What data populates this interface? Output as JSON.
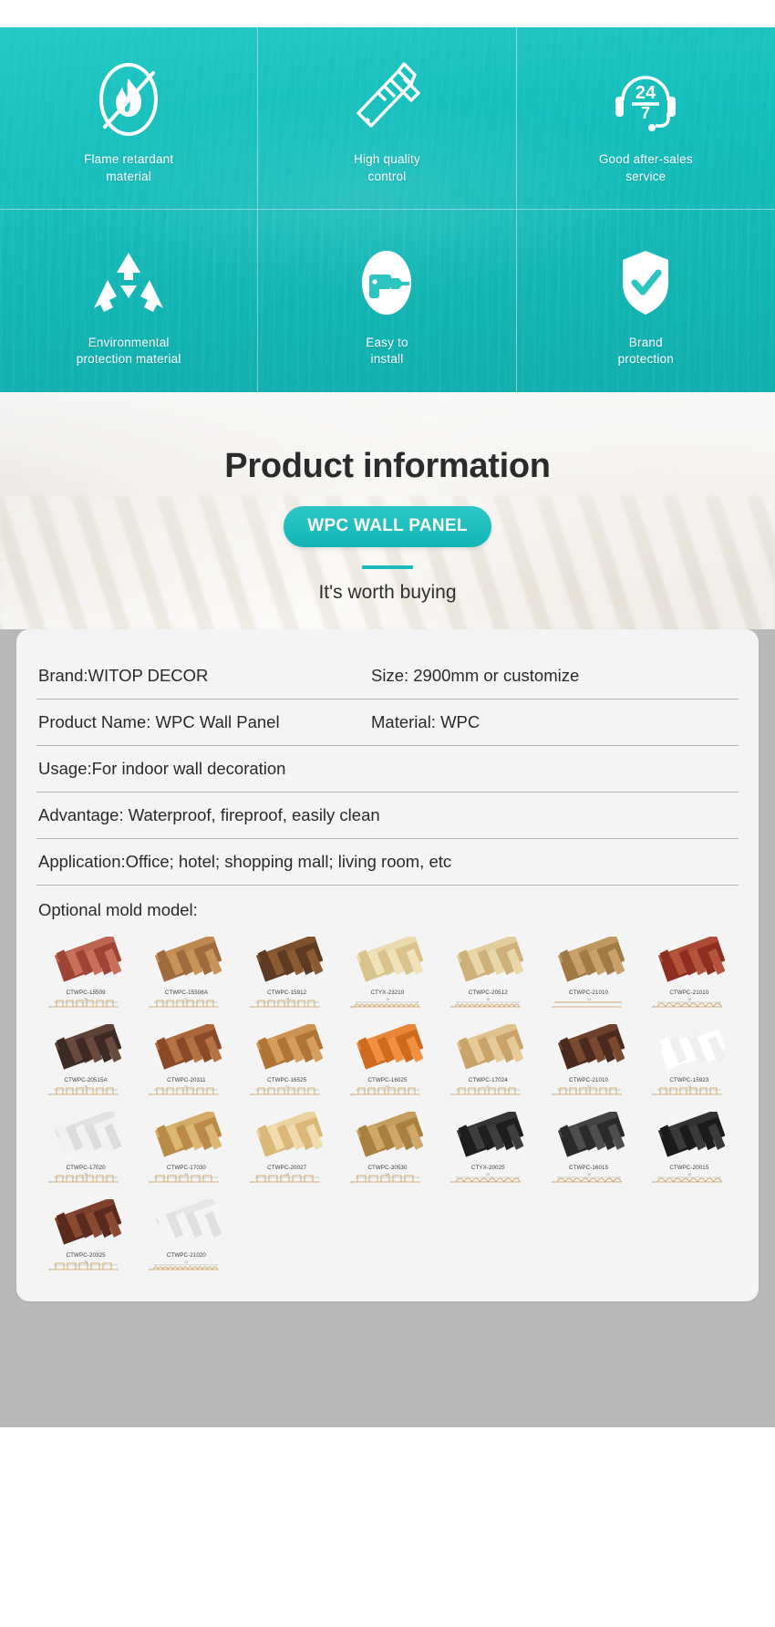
{
  "banner": {
    "features": [
      {
        "icon": "flame-retardant-icon",
        "line1": "Flame retardant",
        "line2": "material"
      },
      {
        "icon": "caliper-quality-icon",
        "line1": "High quality",
        "line2": "control"
      },
      {
        "icon": "headset-24-7-icon",
        "line1": "Good after-sales",
        "line2": "service"
      },
      {
        "icon": "recycle-icon",
        "line1": "Environmental",
        "line2": "protection material"
      },
      {
        "icon": "drill-install-icon",
        "line1": "Easy to",
        "line2": "install"
      },
      {
        "icon": "shield-check-icon",
        "line1": "Brand",
        "line2": "protection"
      }
    ]
  },
  "info": {
    "title": "Product information",
    "pill_label": "WPC WALL PANEL",
    "subtitle": "It's worth buying",
    "accent_color": "#19bcbc"
  },
  "specs": {
    "rows": [
      {
        "left": "Brand:WITOP DECOR",
        "right": "Size: 2900mm or customize"
      },
      {
        "left": "Product Name: WPC Wall Panel",
        "right": "Material: WPC"
      },
      {
        "full": "Usage:For indoor wall decoration"
      },
      {
        "full": "Advantage: Waterproof, fireproof, easily clean"
      },
      {
        "full": "Application:Office; hotel; shopping mall; living room, etc"
      }
    ],
    "mold_title": "Optional mold model:"
  },
  "molds": [
    {
      "code": "CTWPC-15509",
      "dim": "16",
      "color_a": "#9e4436",
      "color_b": "#c8705c",
      "profile": "fluted"
    },
    {
      "code": "CTWPC-15508A",
      "dim": "21",
      "color_a": "#a06b3c",
      "color_b": "#c79358",
      "profile": "fluted"
    },
    {
      "code": "CTWPC-15912",
      "dim": "19",
      "color_a": "#5d3a22",
      "color_b": "#8a5a33",
      "profile": "fluted"
    },
    {
      "code": "CTYX-23210",
      "dim": "18",
      "color_a": "#d9c28c",
      "color_b": "#efe2b9",
      "profile": "wave"
    },
    {
      "code": "CTWPC-20512",
      "dim": "18",
      "color_a": "#cdb07a",
      "color_b": "#e8d7a8",
      "profile": "wave"
    },
    {
      "code": "CTWPC-21010",
      "dim": "14",
      "color_a": "#a07a45",
      "color_b": "#c9a269",
      "profile": "flat"
    },
    {
      "code": "CTWPC-21010",
      "dim": "28",
      "color_a": "#8c2f20",
      "color_b": "#b5543c",
      "profile": "arch"
    },
    {
      "code": "CTWPC-20515A",
      "dim": "25",
      "color_a": "#3d2a24",
      "color_b": "#6a4a3c",
      "profile": "square"
    },
    {
      "code": "CTWPC-20311",
      "dim": "20",
      "color_a": "#8a4a28",
      "color_b": "#b57242",
      "profile": "square"
    },
    {
      "code": "CTWPC-16525",
      "dim": "22",
      "color_a": "#b07436",
      "color_b": "#d69e5c",
      "profile": "square"
    },
    {
      "code": "CTWPC-16025",
      "dim": "20",
      "color_a": "#d06a1f",
      "color_b": "#f09040",
      "profile": "box"
    },
    {
      "code": "CTWPC-17024",
      "dim": "21",
      "color_a": "#c8a46a",
      "color_b": "#e6cb98",
      "profile": "box"
    },
    {
      "code": "CTWPC-21010",
      "dim": "22",
      "color_a": "#4a2a1c",
      "color_b": "#7a4a30",
      "profile": "box"
    },
    {
      "code": "CTWPC-15923",
      "dim": "24",
      "color_a": "#ffffff",
      "color_b": "#efefef",
      "profile": "white-box"
    },
    {
      "code": "CTWPC-17020",
      "dim": "24",
      "color_a": "#f2f2f2",
      "color_b": "#dcdcdc",
      "profile": "white-box"
    },
    {
      "code": "CTWPC-17030",
      "dim": "19",
      "color_a": "#b98b46",
      "color_b": "#dcb673",
      "profile": "step"
    },
    {
      "code": "CTWPC-20027",
      "dim": "20",
      "color_a": "#d9b87a",
      "color_b": "#f0dcac",
      "profile": "step"
    },
    {
      "code": "CTWPC-30530",
      "dim": "28",
      "color_a": "#a9803f",
      "color_b": "#cfa868",
      "profile": "step"
    },
    {
      "code": "CTYX-20025",
      "dim": "20",
      "color_a": "#1e1e1e",
      "color_b": "#3e3e3e",
      "profile": "round"
    },
    {
      "code": "CTWPC-16015",
      "dim": "18",
      "color_a": "#2a2a2a",
      "color_b": "#4e4e4e",
      "profile": "round"
    },
    {
      "code": "CTWPC-20015",
      "dim": "18",
      "color_a": "#1b1b1b",
      "color_b": "#3a3a3a",
      "profile": "round"
    },
    {
      "code": "CTWPC-20325",
      "dim": "24",
      "color_a": "#5a2a1c",
      "color_b": "#8a4a30",
      "profile": "white-step"
    },
    {
      "code": "CTWPC-21020",
      "dim": "24",
      "color_a": "#f5f5f5",
      "color_b": "#e0e0e0",
      "profile": "white-flute"
    }
  ]
}
